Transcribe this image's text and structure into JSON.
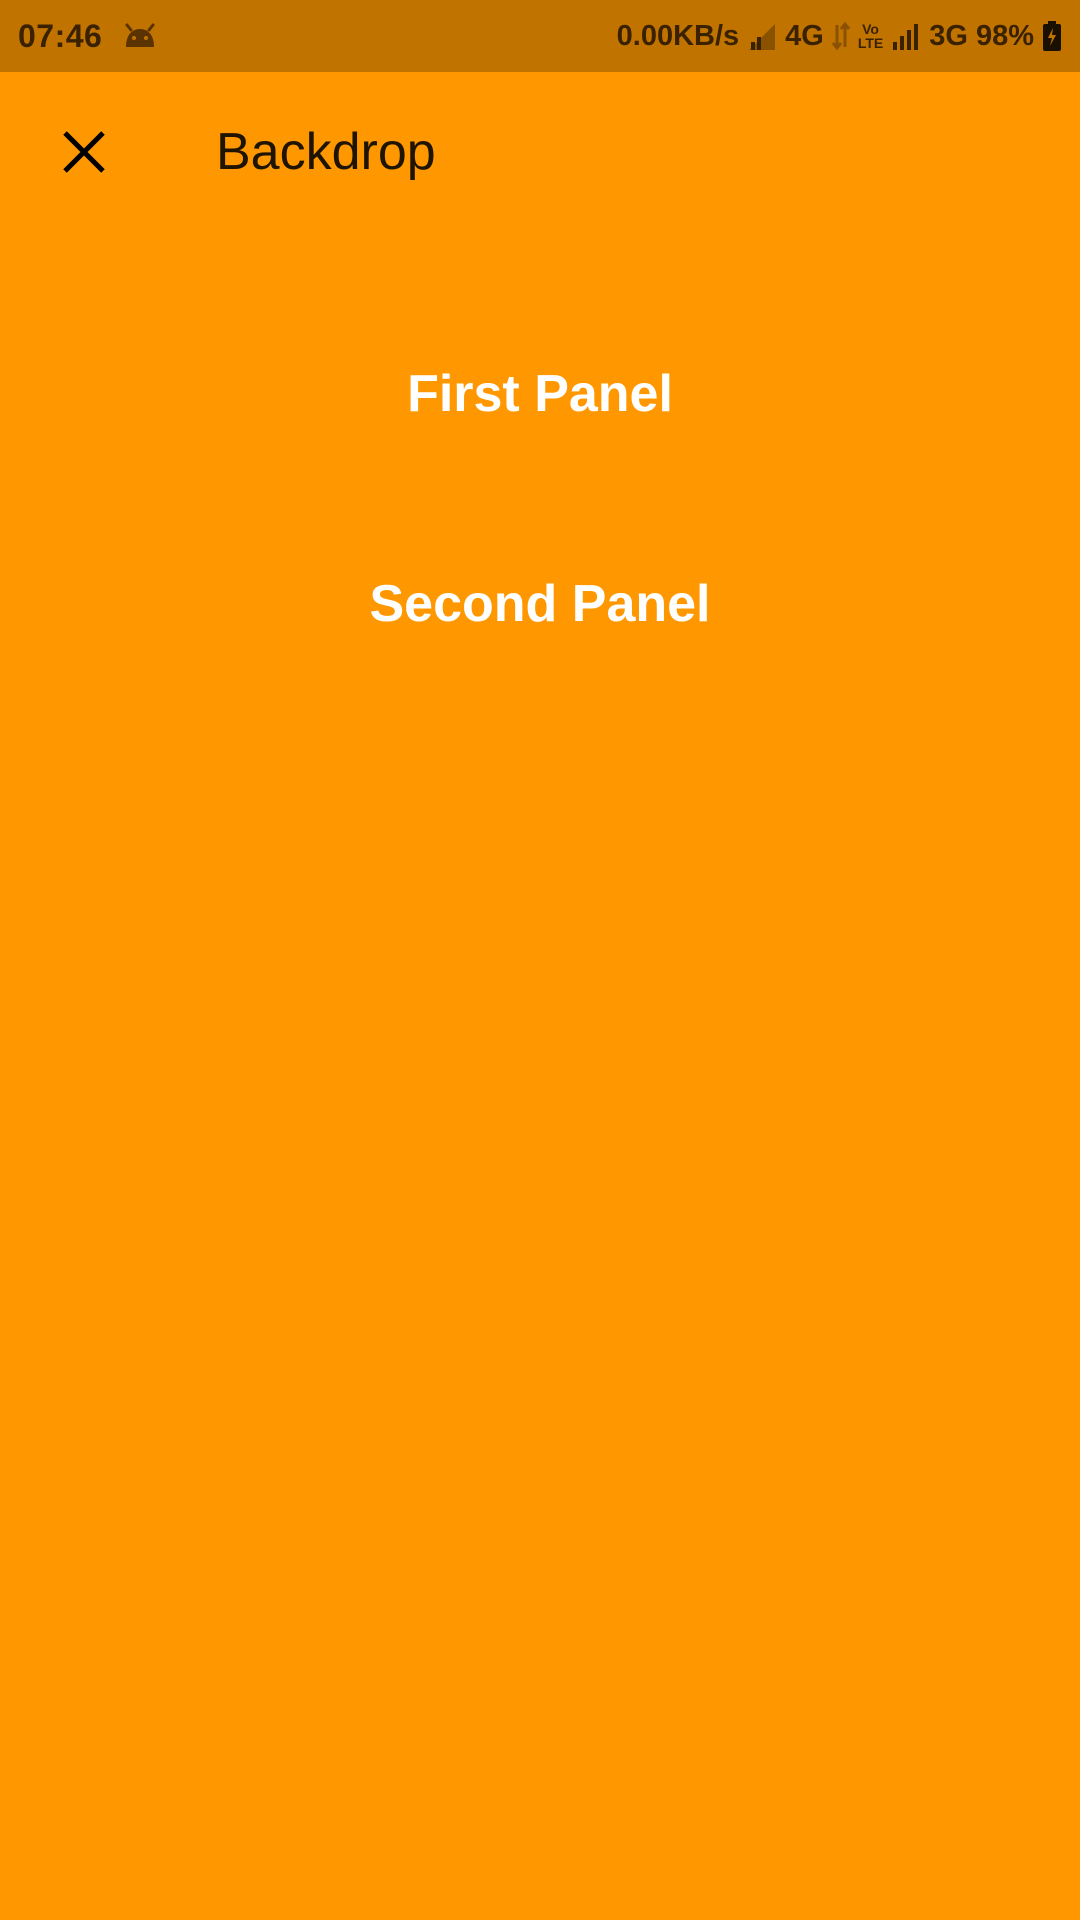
{
  "status_bar": {
    "time": "07:46",
    "net_speed": "0.00KB/s",
    "network_4g": "4G",
    "volte_top": "Vo",
    "volte_bottom": "LTE",
    "network_3g": "3G",
    "battery": "98%",
    "color": "#C17300"
  },
  "app_bar": {
    "title": "Backdrop",
    "close_icon": "close-icon"
  },
  "panels": {
    "first": "First Panel",
    "second": "Second Panel"
  },
  "colors": {
    "background": "#FF9800",
    "panel_text": "#FFFFFF"
  }
}
